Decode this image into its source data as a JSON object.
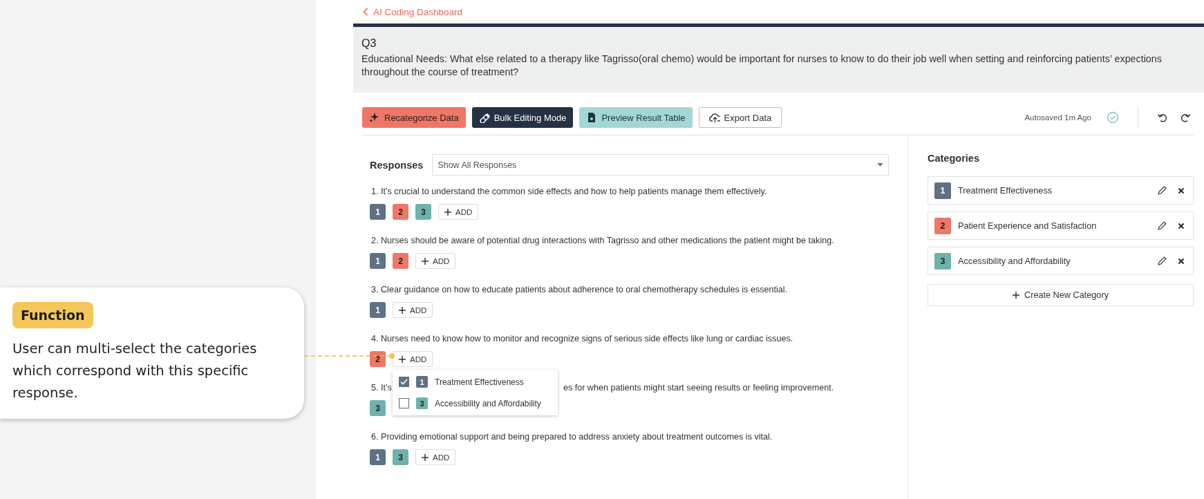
{
  "callout": {
    "badge": "Function",
    "text": "User can multi-select the categories which correspond with this specific response."
  },
  "back_link": "AI Coding Dashboard",
  "question": {
    "number": "Q3",
    "text": "Educational Needs: What else related to a therapy like Tagrisso(oral chemo) would be important for nurses to know to do their job well when setting and reinforcing patients’ expections throughout the course of treatment?"
  },
  "toolbar": {
    "buttons": [
      {
        "label": "Recategorize Data",
        "kind": "recategorize"
      },
      {
        "label": "Bulk Editing Mode",
        "kind": "bulk"
      },
      {
        "label": "Preview Result Table",
        "kind": "preview"
      },
      {
        "label": "Export Data",
        "kind": "export"
      }
    ],
    "autosave": "Autosaved 1m Ago"
  },
  "responses": {
    "title": "Responses",
    "filter": "Show All Responses",
    "items": [
      {
        "text": "1. It’s crucial to understand the common side effects and how to help patients manage them effectively.",
        "tags": [
          {
            "label": "1",
            "color": "#5e7185"
          },
          {
            "label": "2",
            "color": "#ee7766"
          },
          {
            "label": "3",
            "color": "#6fb1ad"
          }
        ],
        "add": "ADD"
      },
      {
        "text": "2. Nurses should be aware of potential drug interactions with Tagrisso and other medications the patient might be taking.",
        "tags": [
          {
            "label": "1",
            "color": "#5e7185"
          },
          {
            "label": "2",
            "color": "#ee7766"
          }
        ],
        "add": "ADD"
      },
      {
        "text": "3. Clear guidance on how to educate patients about adherence to oral chemotherapy schedules is essential.",
        "tags": [
          {
            "label": "1",
            "color": "#5e7185"
          }
        ],
        "add": "ADD"
      },
      {
        "text": "4. Nurses need to know how to monitor and recognize signs of serious side effects like lung or cardiac issues.",
        "tags": [
          {
            "label": "2",
            "color": "#ee7766"
          }
        ],
        "add": "ADD",
        "menu": [
          {
            "label": "1",
            "name": "Treatment Effectiveness",
            "color": "#5e7185",
            "checked": true
          },
          {
            "label": "3",
            "name": "Accessibility and Affordability",
            "color": "#6fb1ad",
            "checked": false
          }
        ]
      },
      {
        "text_start": "5. It’s",
        "text_end": "es for when patients might start seeing results or feeling improvement.",
        "tags": [
          {
            "label": "3",
            "color": "#6fb1ad"
          }
        ]
      },
      {
        "text": "6. Providing emotional support and being prepared to address anxiety about treatment outcomes is vital.",
        "tags": [
          {
            "label": "1",
            "color": "#5e7185"
          },
          {
            "label": "3",
            "color": "#6fb1ad"
          }
        ],
        "add": "ADD"
      }
    ]
  },
  "categories": {
    "title": "Categories",
    "items": [
      {
        "label": "1",
        "name": "Treatment Effectiveness",
        "color": "#5e7185"
      },
      {
        "label": "2",
        "name": "Patient Experience and Satisfaction",
        "color": "#ee7766"
      },
      {
        "label": "3",
        "name": "Accessibility and Affordability",
        "color": "#6fb1ad"
      }
    ],
    "create": "Create New Category"
  }
}
